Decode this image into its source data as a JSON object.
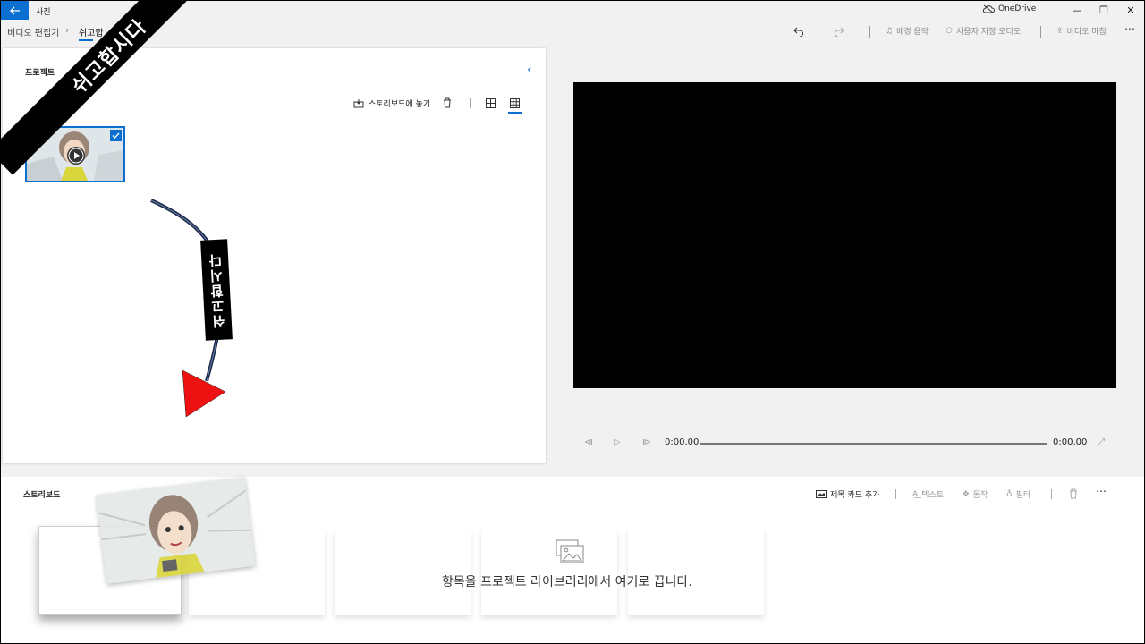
{
  "titlebar": {
    "back_icon": "arrow-left-icon",
    "app_name": "사진",
    "cloud": "OneDrive",
    "minimize": "—",
    "restore": "❐",
    "close": "✕"
  },
  "breadcrumb": {
    "parent": "비디오 편집기",
    "current": "쉬고합"
  },
  "toolbar": {
    "background_music": "배경 음악",
    "custom_audio": "사용자 지정 오디오",
    "finish_video": "비디오 마침",
    "more": "⋯"
  },
  "library": {
    "title": "프로젝트",
    "place_in_storyboard": "스토리보드에 놓기"
  },
  "annotations": {
    "banner": "쉬고합시다",
    "vertical_label": "쉬고합시다"
  },
  "player": {
    "current_time": "0:00.00",
    "total_time": "0:00.00"
  },
  "storyboard": {
    "title": "스토리보드",
    "add_title_card": "제목 카드 추가",
    "text": "텍스트",
    "motion": "동작",
    "filters": "필터",
    "more": "⋯",
    "empty_message": "항목을 프로젝트 라이브러리에서 여기로 끕니다."
  },
  "colors": {
    "accent": "#0a6fd1",
    "arrow": "#ee1111"
  }
}
